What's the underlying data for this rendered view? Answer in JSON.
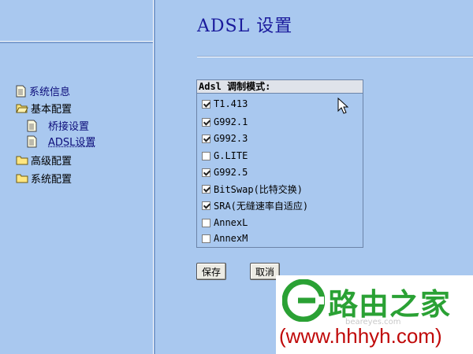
{
  "nav": {
    "items": [
      {
        "label": "系统信息",
        "icon": "page-icon"
      },
      {
        "label": "基本配置",
        "icon": "folder-open-icon"
      },
      {
        "label": "桥接设置",
        "icon": "page-icon"
      },
      {
        "label": "ADSL设置",
        "icon": "page-icon"
      },
      {
        "label": "高级配置",
        "icon": "folder-icon"
      },
      {
        "label": "系统配置",
        "icon": "folder-icon"
      }
    ]
  },
  "page": {
    "title": "ADSL 设置"
  },
  "modulation": {
    "header": "Adsl 调制模式:",
    "options": [
      {
        "label": "T1.413",
        "checked": true
      },
      {
        "label": "G992.1",
        "checked": true
      },
      {
        "label": "G992.3",
        "checked": true
      },
      {
        "label": "G.LITE",
        "checked": false
      },
      {
        "label": "G992.5",
        "checked": true
      },
      {
        "label": "BitSwap(比特交换)",
        "checked": true
      },
      {
        "label": "SRA(无缝速率自适应)",
        "checked": true
      },
      {
        "label": "AnnexL",
        "checked": false
      },
      {
        "label": "AnnexM",
        "checked": false
      }
    ]
  },
  "buttons": {
    "save": "保存",
    "cancel": "取消"
  },
  "watermark": {
    "title": "路由之家",
    "subtitle": "beareyes.com",
    "url": "(www.hhhyh.com)",
    "brand_color": "#2aa134",
    "url_color": "#c00a0a"
  }
}
